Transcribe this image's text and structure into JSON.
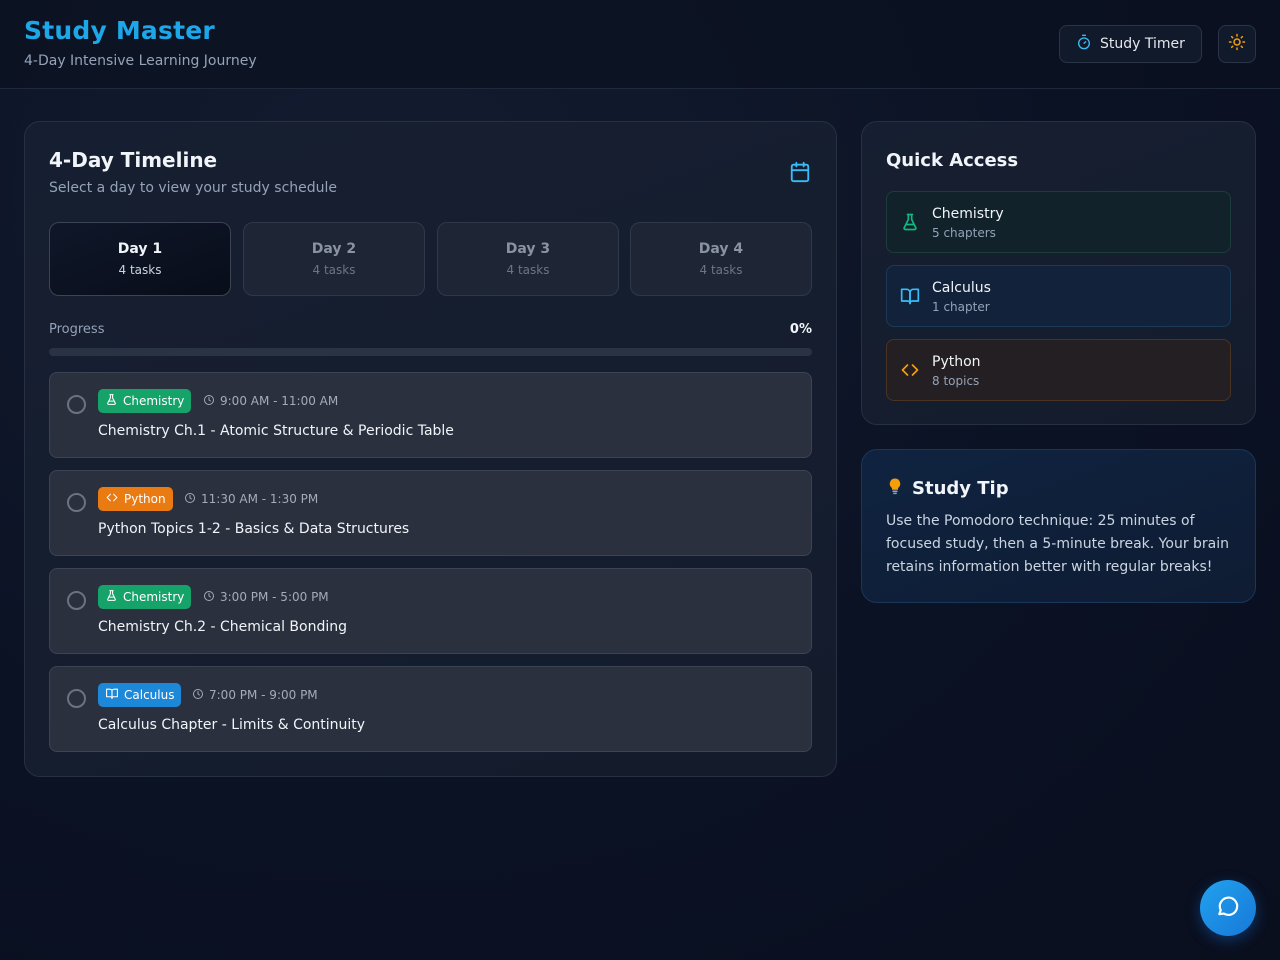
{
  "header": {
    "title": "Study Master",
    "subtitle": "4-Day Intensive Learning Journey",
    "timer_label": "Study Timer",
    "timer_icon": "stopwatch-icon",
    "theme_icon": "sun-icon"
  },
  "timeline": {
    "title": "4-Day Timeline",
    "subtitle": "Select a day to view your study schedule",
    "icon": "calendar-icon",
    "days": [
      {
        "label": "Day 1",
        "tasks": "4 tasks",
        "active": true
      },
      {
        "label": "Day 2",
        "tasks": "4 tasks",
        "active": false
      },
      {
        "label": "Day 3",
        "tasks": "4 tasks",
        "active": false
      },
      {
        "label": "Day 4",
        "tasks": "4 tasks",
        "active": false
      }
    ],
    "progress_label": "Progress",
    "progress_value": "0%",
    "progress_fraction": 0,
    "tasks": [
      {
        "subject": "Chemistry",
        "icon": "flask-icon",
        "time": "9:00 AM - 11:00 AM",
        "name": "Chemistry Ch.1 - Atomic Structure & Periodic Table",
        "color": "#16a36a",
        "done": false
      },
      {
        "subject": "Python",
        "icon": "code-icon",
        "time": "11:30 AM - 1:30 PM",
        "name": "Python Topics 1-2 - Basics & Data Structures",
        "color": "#ea7a12",
        "done": false
      },
      {
        "subject": "Chemistry",
        "icon": "flask-icon",
        "time": "3:00 PM - 5:00 PM",
        "name": "Chemistry Ch.2 - Chemical Bonding",
        "color": "#16a36a",
        "done": false
      },
      {
        "subject": "Calculus",
        "icon": "book-icon",
        "time": "7:00 PM - 9:00 PM",
        "name": "Calculus Chapter - Limits & Continuity",
        "color": "#1e88d8",
        "done": false
      }
    ]
  },
  "quick_access": {
    "title": "Quick Access",
    "items": [
      {
        "name": "Chemistry",
        "count": "5 chapters",
        "icon": "flask-icon",
        "color": "#10b981"
      },
      {
        "name": "Calculus",
        "count": "1 chapter",
        "icon": "book-icon",
        "color": "#38bdf8"
      },
      {
        "name": "Python",
        "count": "8 topics",
        "icon": "code-icon",
        "color": "#f59e0b"
      }
    ]
  },
  "tip": {
    "title": "Study Tip",
    "icon": "lightbulb-icon",
    "body": "Use the Pomodoro technique: 25 minutes of focused study, then a 5-minute break. Your brain retains information better with regular breaks!"
  },
  "chat": {
    "icon": "chat-bubble-icon"
  }
}
